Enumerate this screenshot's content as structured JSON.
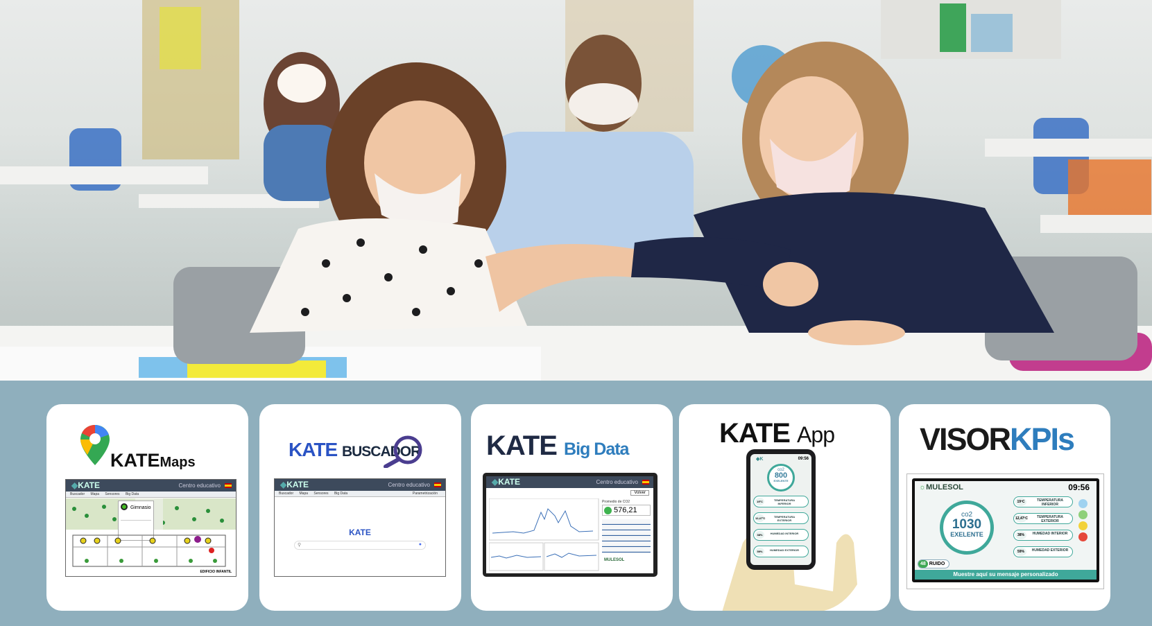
{
  "cards": {
    "maps": {
      "title_kate": "KATE",
      "title_rest": "Maps",
      "screen": {
        "logo": "KATE",
        "centro": "Centro educativo",
        "nav": [
          "Buscador",
          "Mapa",
          "Sensores",
          "Big Data"
        ],
        "popup_title": "Gimnasio",
        "footer": "EDIFICIO INFANTIL"
      }
    },
    "buscador": {
      "title_kate": "KATE",
      "title_rest": "BUSCADOR",
      "screen": {
        "logo": "KATE",
        "centro": "Centro educativo",
        "nav": [
          "Buscador",
          "Mapa",
          "Sensores",
          "Big Data"
        ],
        "right_nav": "Parametrización",
        "search_logo": "KATE"
      }
    },
    "bigdata": {
      "title_kate": "KATE",
      "title_rest": "Big Data",
      "screen": {
        "logo": "KATE",
        "centro": "Centro educativo",
        "btn": "Volver",
        "co2_label": "Promedio de CO2",
        "co2_value": "576,21",
        "brand": "MULESOL"
      }
    },
    "app": {
      "title_kate": "KATE",
      "title_rest": "App",
      "phone": {
        "time": "09:56",
        "co2_label": "co2",
        "co2_value": "800",
        "co2_status": "EXELENTE",
        "rows": [
          {
            "value": "19ºC",
            "label": "TEMPERATURA INFERIOR"
          },
          {
            "value": "12,47ºC",
            "label": "TEMPERATURA EXTERIOR"
          },
          {
            "value": "38%",
            "label": "HUMEDAD INTERIOR"
          },
          {
            "value": "59%",
            "label": "HUMEDAD EXTERIOR"
          }
        ]
      }
    },
    "visor": {
      "title_a": "VISOR",
      "title_b": "KPIs",
      "screen": {
        "brand": "MULESOL",
        "time": "09:56",
        "co2_label": "co2",
        "co2_value": "1030",
        "co2_status": "EXELENTE",
        "rows": [
          {
            "value": "19ºC",
            "label": "TEMPERATURA INFERIOR"
          },
          {
            "value": "12,47ºC",
            "label": "TEMPERATURA EXTERIOR"
          },
          {
            "value": "38%",
            "label": "HUMEDAD INTERIOR"
          },
          {
            "value": "59%",
            "label": "HUMEDAD EXTERIOR"
          }
        ],
        "noise_value": "48",
        "noise_label": "RUIDO",
        "message": "Muestre aquí su mensaje personalizado"
      }
    }
  },
  "colors": {
    "background_strip": "#8fafbd",
    "kate_blue": "#1f2a44",
    "accent_blue": "#2e7dbd",
    "teal": "#3fa89a"
  }
}
